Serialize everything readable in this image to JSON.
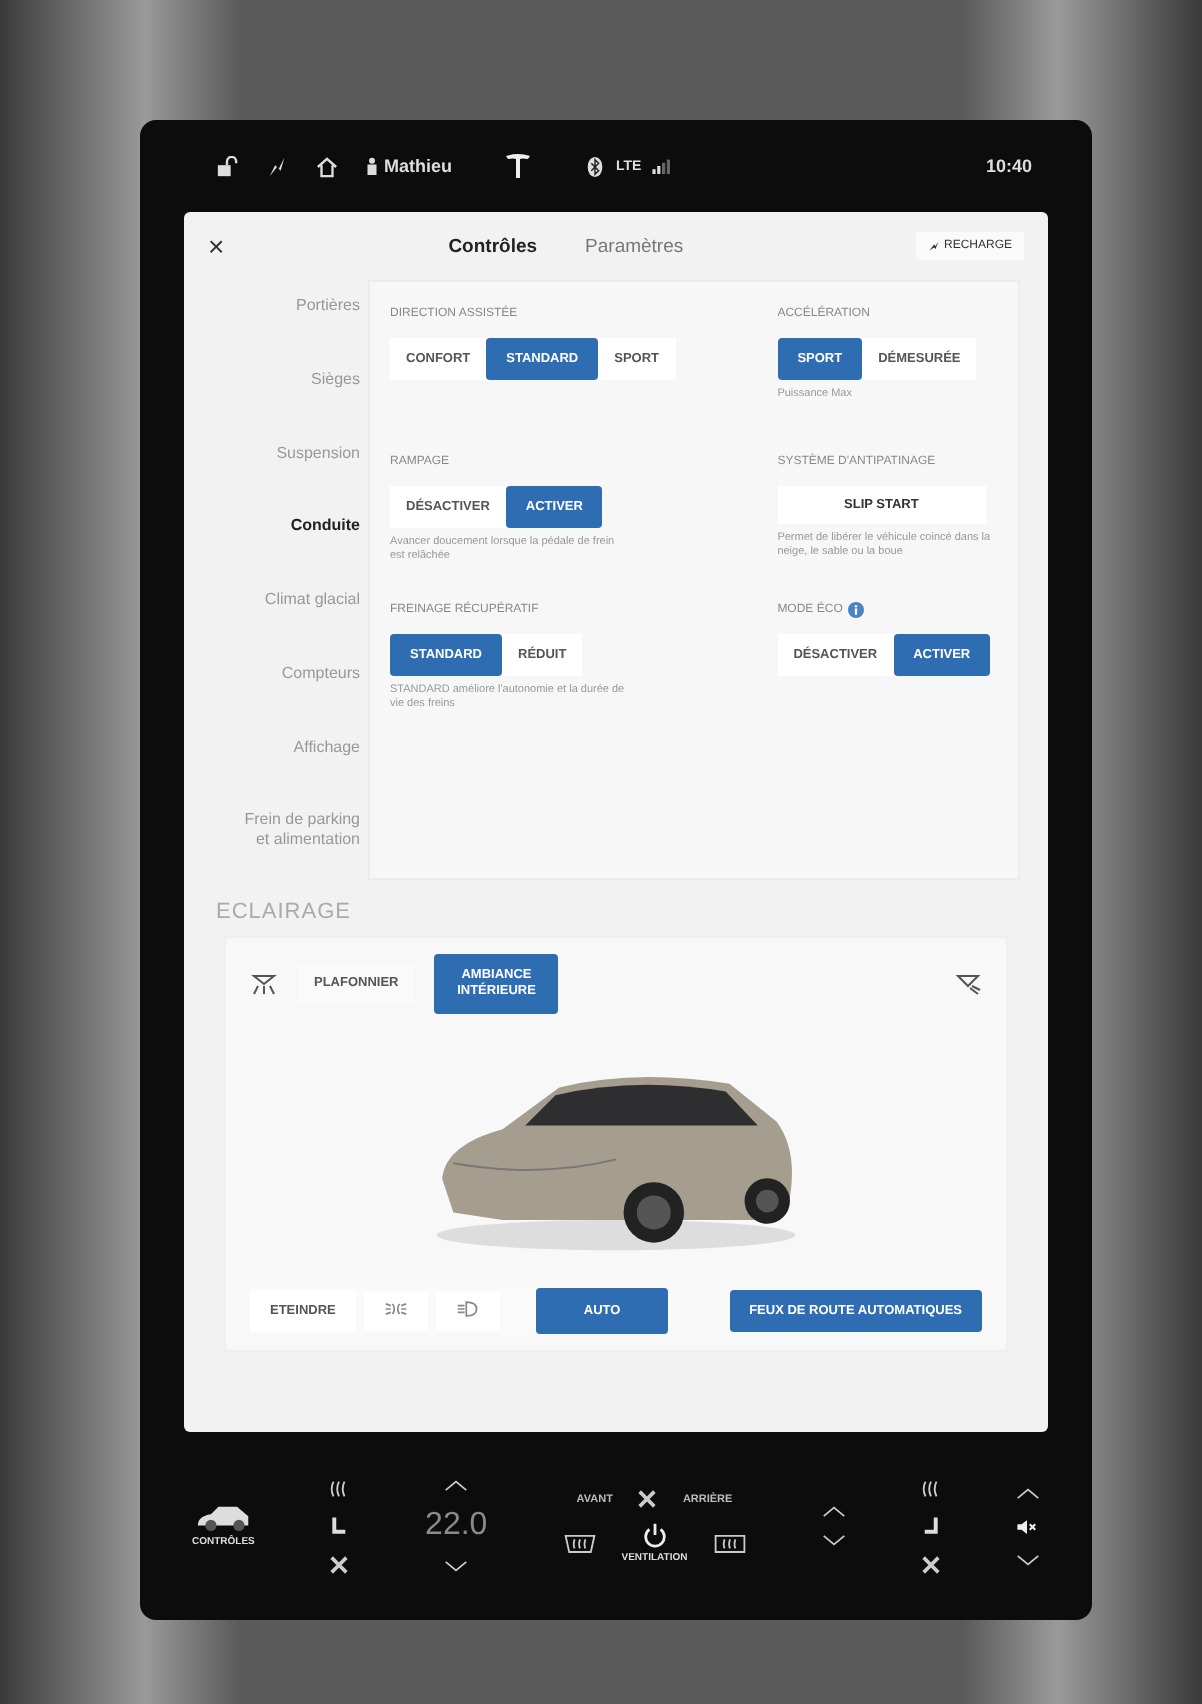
{
  "status_bar": {
    "user": "Mathieu",
    "network": "LTE",
    "time": "10:40"
  },
  "header": {
    "close_button": "×",
    "tabs": [
      {
        "label": "Contrôles",
        "selected": true
      },
      {
        "label": "Paramètres",
        "selected": false
      }
    ],
    "recharge_button": "RECHARGE"
  },
  "sidebar": {
    "items": [
      {
        "label": "Portières",
        "selected": false
      },
      {
        "label": "Sièges",
        "selected": false
      },
      {
        "label": "Suspension",
        "selected": false
      },
      {
        "label": "Conduite",
        "selected": true
      },
      {
        "label": "Climat glacial",
        "selected": false
      },
      {
        "label": "Compteurs",
        "selected": false
      },
      {
        "label": "Affichage",
        "selected": false
      },
      {
        "label": "Frein de parking et alimentation",
        "selected": false
      }
    ]
  },
  "settings": [
    {
      "title": "DIRECTION ASSISTÉE",
      "kind": "segmented",
      "info_icon": false,
      "options": [
        {
          "label": "CONFORT",
          "selected": false
        },
        {
          "label": "STANDARD",
          "selected": true
        },
        {
          "label": "SPORT",
          "selected": false
        }
      ]
    },
    {
      "title": "ACCÉLÉRATION",
      "kind": "segmented",
      "info_icon": false,
      "options": [
        {
          "label": "SPORT",
          "selected": true
        },
        {
          "label": "DÉMESURÉE",
          "selected": false
        }
      ],
      "note": "Puissance Max"
    },
    {
      "title": "RAMPAGE",
      "kind": "segmented",
      "info_icon": false,
      "options": [
        {
          "label": "DÉSACTIVER",
          "selected": false
        },
        {
          "label": "ACTIVER",
          "selected": true
        }
      ],
      "note": "Avancer doucement lorsque la pédale de frein est relâchée"
    },
    {
      "title": "SYSTÈME D'ANTIPATINAGE",
      "kind": "single",
      "info_icon": false,
      "options": [
        {
          "label": "SLIP START",
          "selected": false
        }
      ],
      "note": "Permet de libérer le véhicule coincé dans la neige, le sable ou la boue"
    },
    {
      "title": "FREINAGE RÉCUPÉRATIF",
      "kind": "segmented",
      "info_icon": false,
      "options": [
        {
          "label": "STANDARD",
          "selected": true
        },
        {
          "label": "RÉDUIT",
          "selected": false
        }
      ],
      "note": "STANDARD améliore l'autonomie et la durée de vie des freins"
    },
    {
      "title": "MODE ÉCO",
      "kind": "segmented",
      "info_icon": true,
      "options": [
        {
          "label": "DÉSACTIVER",
          "selected": false
        },
        {
          "label": "ACTIVER",
          "selected": true
        }
      ]
    }
  ],
  "lighting": {
    "title": "ECLAIRAGE",
    "light_buttons": [
      {
        "label": "PLAFONNIER",
        "selected": false
      },
      {
        "label": "AMBIANCE INTÉRIEURE",
        "selected": true
      }
    ],
    "headlights": [
      {
        "kind": "text",
        "label": "ETEINDRE",
        "selected": false
      },
      {
        "kind": "icon",
        "selected": false
      },
      {
        "kind": "icon",
        "selected": false
      },
      {
        "kind": "text",
        "label": "AUTO",
        "selected": true
      }
    ],
    "auto_high_beam": {
      "label": "FEUX DE ROUTE AUTOMATIQUES",
      "on": true
    }
  },
  "dock": {
    "controls_label": "CONTRÔLES",
    "driver_temp": "22.0",
    "fan_front": "AVANT",
    "fan_rear": "ARRIÈRE",
    "ventilation_label": "VENTILATION"
  }
}
